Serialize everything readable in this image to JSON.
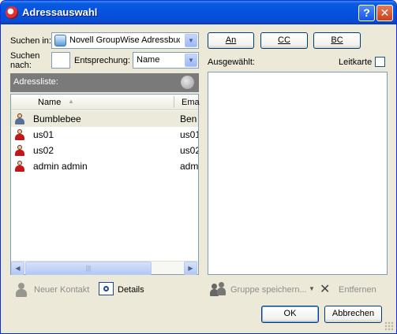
{
  "window": {
    "title": "Adressauswahl",
    "help_glyph": "?",
    "close_glyph": "✕"
  },
  "search": {
    "in_label": "Suchen in:",
    "in_value": "Novell GroupWise Adressbuch",
    "nach_label_1": "Suchen",
    "nach_label_2": "nach:",
    "nach_value": "",
    "match_label": "Entsprechung:",
    "match_value": "Name"
  },
  "address_list": {
    "header": "Adressliste:",
    "columns": [
      "Name",
      "Ema"
    ],
    "rows": [
      {
        "name": "Bumblebee",
        "email": "Ben",
        "icon": "contact-blue"
      },
      {
        "name": "us01",
        "email": "us01",
        "icon": "contact-red"
      },
      {
        "name": "us02",
        "email": "us02",
        "icon": "contact-red"
      },
      {
        "name": "admin admin",
        "email": "adm",
        "icon": "contact-red"
      }
    ],
    "scroll_left": "◀",
    "scroll_right": "▶",
    "scroll_grip": "|||"
  },
  "recipients": {
    "to": "An",
    "cc": "CC",
    "bc": "BC"
  },
  "selected": {
    "label": "Ausgewählt:",
    "leitkarte_label": "Leitkarte",
    "leitkarte_checked": false
  },
  "actions": {
    "new_contact": "Neuer Kontakt",
    "details": "Details",
    "save_group": "Gruppe speichern...",
    "remove": "Entfernen",
    "ok": "OK",
    "cancel": "Abbrechen"
  },
  "icons": {
    "dropdown": "▼",
    "remove": "✕",
    "sort": "▲"
  }
}
